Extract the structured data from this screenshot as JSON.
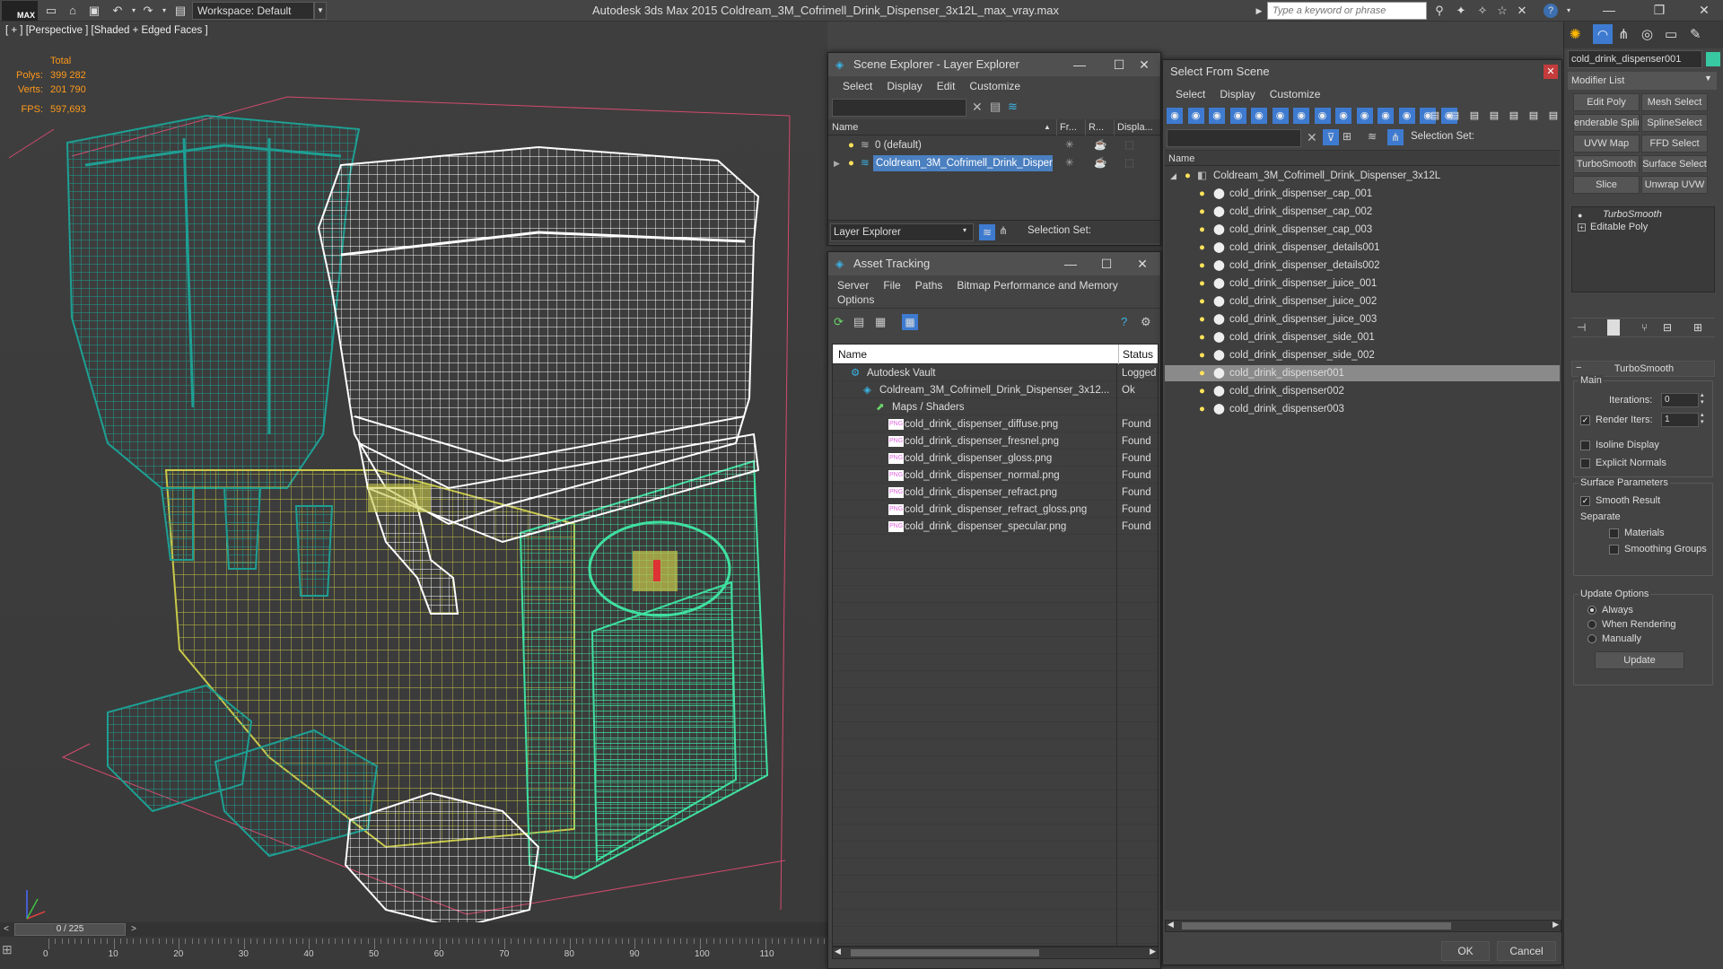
{
  "app": {
    "title": "Autodesk 3ds Max  2015     Coldream_3M_Cofrimell_Drink_Dispenser_3x12L_max_vray.max",
    "logo": "MAX",
    "workspace": "Workspace: Default",
    "keyword_placeholder": "Type a keyword or phrase"
  },
  "viewport": {
    "label": "[ + ] [Perspective ] [Shaded + Edged Faces ]",
    "stats": {
      "total_label": "Total",
      "polys_label": "Polys:",
      "polys": "399 282",
      "verts_label": "Verts:",
      "verts": "201 790",
      "fps_label": "FPS:",
      "fps": "597,693"
    },
    "colors": {
      "teal": "#1e9f93",
      "yellow": "#c8c84a",
      "green": "#3fe0a0",
      "white": "#ffffff",
      "pink": "#d24b6e"
    }
  },
  "timeline": {
    "frame": "0 / 225",
    "ticks": [
      "0",
      "10",
      "20",
      "30",
      "40",
      "50",
      "60",
      "70",
      "80",
      "90",
      "100",
      "110"
    ]
  },
  "scene_explorer": {
    "title": "Scene Explorer - Layer Explorer",
    "menu": [
      "Select",
      "Display",
      "Edit",
      "Customize"
    ],
    "columns": [
      "Name",
      "Fr...",
      "R...",
      "Displa..."
    ],
    "rows": [
      {
        "label": "0 (default)",
        "selected": false
      },
      {
        "label": "Coldream_3M_Cofrimell_Drink_Dispen...",
        "selected": true
      }
    ],
    "footer_dropdown": "Layer Explorer",
    "selection_set_label": "Selection Set:"
  },
  "asset_tracking": {
    "title": "Asset Tracking",
    "menu": [
      "Server",
      "File",
      "Paths",
      "Bitmap Performance and Memory"
    ],
    "menu2": [
      "Options"
    ],
    "columns": [
      "Name",
      "Status"
    ],
    "rows": [
      {
        "name": "Autodesk Vault",
        "status": "Logged",
        "indent": 1,
        "icon": "vault-icon"
      },
      {
        "name": "Coldream_3M_Cofrimell_Drink_Dispenser_3x12...",
        "status": "Ok",
        "indent": 2,
        "icon": "max-file-icon"
      },
      {
        "name": "Maps / Shaders",
        "status": "",
        "indent": 3,
        "icon": "maps-icon"
      },
      {
        "name": "cold_drink_dispenser_diffuse.png",
        "status": "Found",
        "indent": 4,
        "icon": "png-icon"
      },
      {
        "name": "cold_drink_dispenser_fresnel.png",
        "status": "Found",
        "indent": 4,
        "icon": "png-icon"
      },
      {
        "name": "cold_drink_dispenser_gloss.png",
        "status": "Found",
        "indent": 4,
        "icon": "png-icon"
      },
      {
        "name": "cold_drink_dispenser_normal.png",
        "status": "Found",
        "indent": 4,
        "icon": "png-icon"
      },
      {
        "name": "cold_drink_dispenser_refract.png",
        "status": "Found",
        "indent": 4,
        "icon": "png-icon"
      },
      {
        "name": "cold_drink_dispenser_refract_gloss.png",
        "status": "Found",
        "indent": 4,
        "icon": "png-icon"
      },
      {
        "name": "cold_drink_dispenser_specular.png",
        "status": "Found",
        "indent": 4,
        "icon": "png-icon"
      }
    ]
  },
  "select_from_scene": {
    "title": "Select From Scene",
    "menu": [
      "Select",
      "Display",
      "Customize"
    ],
    "selection_set_label": "Selection Set:",
    "column": "Name",
    "root": "Coldream_3M_Cofrimell_Drink_Dispenser_3x12L",
    "items": [
      {
        "label": "cold_drink_dispenser_cap_001",
        "selected": false
      },
      {
        "label": "cold_drink_dispenser_cap_002",
        "selected": false
      },
      {
        "label": "cold_drink_dispenser_cap_003",
        "selected": false
      },
      {
        "label": "cold_drink_dispenser_details001",
        "selected": false
      },
      {
        "label": "cold_drink_dispenser_details002",
        "selected": false
      },
      {
        "label": "cold_drink_dispenser_juice_001",
        "selected": false
      },
      {
        "label": "cold_drink_dispenser_juice_002",
        "selected": false
      },
      {
        "label": "cold_drink_dispenser_juice_003",
        "selected": false
      },
      {
        "label": "cold_drink_dispenser_side_001",
        "selected": false
      },
      {
        "label": "cold_drink_dispenser_side_002",
        "selected": false
      },
      {
        "label": "cold_drink_dispenser001",
        "selected": true
      },
      {
        "label": "cold_drink_dispenser002",
        "selected": false
      },
      {
        "label": "cold_drink_dispenser003",
        "selected": false
      }
    ],
    "ok": "OK",
    "cancel": "Cancel"
  },
  "command_panel": {
    "object_name": "cold_drink_dispenser001",
    "modifier_list": "Modifier List",
    "buttons": [
      "Edit Poly",
      "Mesh Select",
      "enderable Splir",
      "SplineSelect",
      "UVW Map",
      "FFD Select",
      "TurboSmooth",
      "Surface Select",
      "Slice",
      "Unwrap UVW"
    ],
    "stack": [
      {
        "label": "TurboSmooth",
        "italic": true
      },
      {
        "label": "Editable Poly",
        "italic": false
      }
    ],
    "rollout_title": "TurboSmooth",
    "main_label": "Main",
    "iterations_label": "Iterations:",
    "iterations": "0",
    "render_iters_label": "Render Iters:",
    "render_iters": "1",
    "isoline": "Isoline Display",
    "explicit_normals": "Explicit Normals",
    "surface_params": "Surface Parameters",
    "smooth_result": "Smooth Result",
    "separate": "Separate",
    "materials": "Materials",
    "smoothing_groups": "Smoothing Groups",
    "update_options": "Update Options",
    "always": "Always",
    "when_rendering": "When Rendering",
    "manually": "Manually",
    "update": "Update"
  }
}
